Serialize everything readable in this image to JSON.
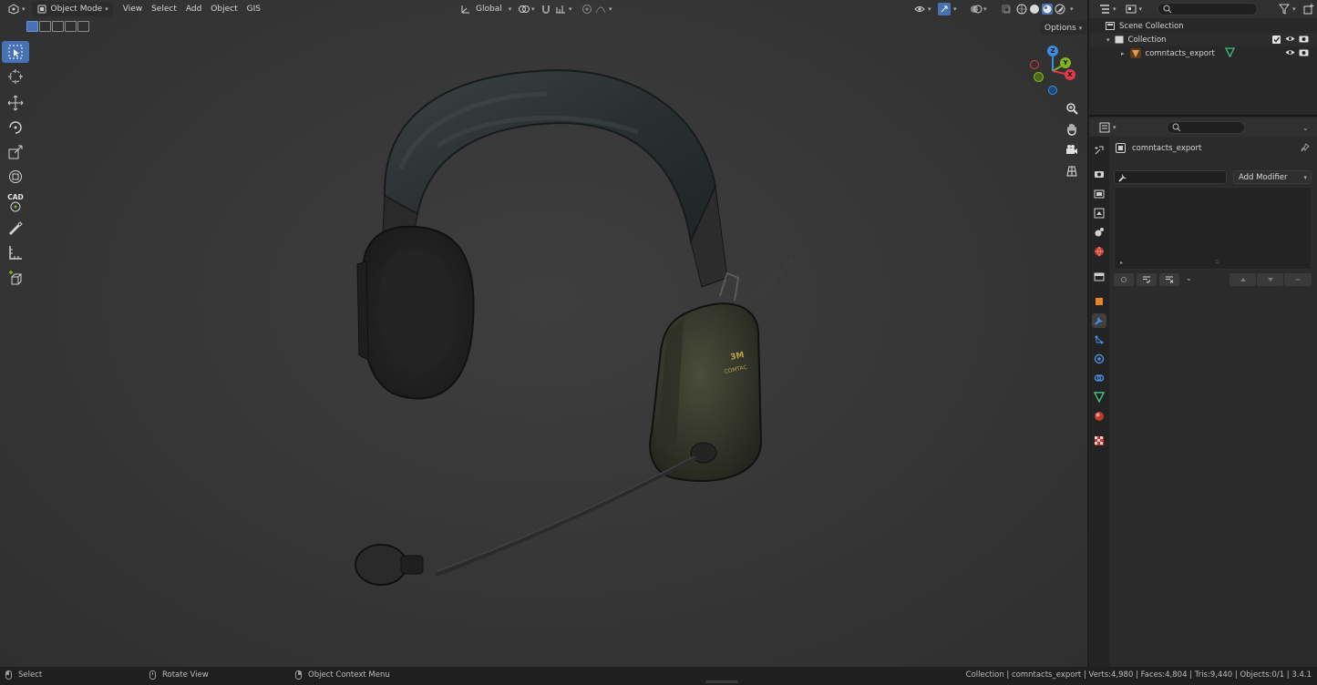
{
  "header": {
    "editor_type_icon": "3d-viewport-icon",
    "mode": "Object Mode",
    "menus": [
      "View",
      "Select",
      "Add",
      "Object",
      "GIS"
    ],
    "transform_orientation": "Global"
  },
  "viewport": {
    "options_label": "Options",
    "gizmo_axes": [
      "X",
      "Y",
      "Z"
    ],
    "tools": [
      "select-box-icon",
      "cursor-icon",
      "move-icon",
      "rotate-icon",
      "scale-icon",
      "transform-icon",
      "cad-icon",
      "annotate-icon",
      "measure-icon",
      "add-cube-icon"
    ],
    "cad_label": "CAD",
    "product_logo": "3M",
    "product_label": "COMTAC"
  },
  "outliner": {
    "rows": [
      {
        "label": "Scene Collection",
        "icon": "scene-collection-icon"
      },
      {
        "label": "Collection",
        "icon": "collection-icon"
      },
      {
        "label": "comntacts_export",
        "icon": "object-icon"
      }
    ]
  },
  "properties": {
    "object_name": "comntacts_export",
    "add_modifier_label": "Add Modifier",
    "tabs": [
      "tool-icon",
      "render-icon",
      "output-icon",
      "view-layer-icon",
      "scene-icon",
      "world-icon",
      "collection-icon",
      "object-icon",
      "modifier-icon",
      "particles-icon",
      "physics-icon",
      "constraints-icon",
      "data-icon",
      "material-icon",
      "texture-icon"
    ]
  },
  "statusbar": {
    "left_items": [
      "Select",
      "Rotate View",
      "Object Context Menu"
    ],
    "stats": "Collection | comntacts_export | Verts:4,980 | Faces:4,804 | Tris:9,440 | Objects:0/1 | 3.4.1"
  },
  "colors": {
    "accent": "#4772b3",
    "x_axis": "#e03a4a",
    "y_axis": "#7fb321",
    "z_axis": "#3b8fe0"
  }
}
